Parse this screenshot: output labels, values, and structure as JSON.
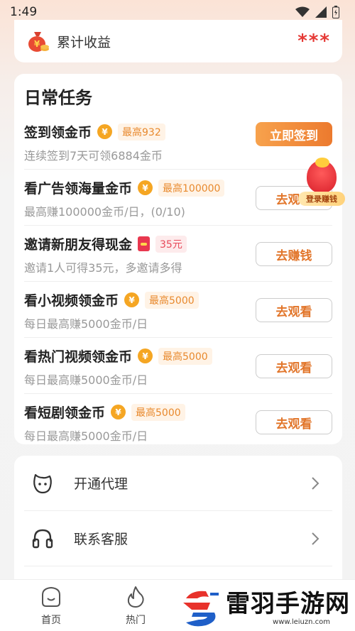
{
  "status_bar": {
    "time": "1:49"
  },
  "earnings": {
    "label": "累计收益",
    "value": "***"
  },
  "daily_tasks": {
    "title": "日常任务",
    "items": [
      {
        "name": "签到领金币",
        "icon": "coin-icon",
        "badge": "最高932",
        "desc": "连续签到7天可领6884金币",
        "button": "立即签到"
      },
      {
        "name": "看广告领海量金币",
        "icon": "coin-icon",
        "badge": "最高100000",
        "desc": "最高赚100000金币/日，(0/10)",
        "button": "去观看"
      },
      {
        "name": "邀请新朋友得现金",
        "icon": "red-packet-icon",
        "badge": "35元",
        "desc": "邀请1人可得35元，多邀请多得",
        "button": "去赚钱"
      },
      {
        "name": "看小视频领金币",
        "icon": "coin-icon",
        "badge": "最高5000",
        "desc": "每日最高赚5000金币/日",
        "button": "去观看"
      },
      {
        "name": "看热门视频领金币",
        "icon": "coin-icon",
        "badge": "最高5000",
        "desc": "每日最高赚5000金币/日",
        "button": "去观看"
      },
      {
        "name": "看短剧领金币",
        "icon": "coin-icon",
        "badge": "最高5000",
        "desc": "每日最高赚5000金币/日",
        "button": "去观看"
      }
    ]
  },
  "coin_symbol": "¥",
  "float_badge": {
    "label": "登录赚钱"
  },
  "menu": {
    "items": [
      {
        "label": "开通代理",
        "icon": "face-icon"
      },
      {
        "label": "联系客服",
        "icon": "headset-icon"
      }
    ]
  },
  "tabs": [
    {
      "label": "首页",
      "icon": "home-icon"
    },
    {
      "label": "热门",
      "icon": "flame-icon"
    }
  ],
  "watermark": {
    "text": "雷羽手游网",
    "url": "www.leiuzn.com"
  },
  "colors": {
    "accent": "#ec7a2e",
    "gold": "#f5a623",
    "red": "#e53935"
  }
}
